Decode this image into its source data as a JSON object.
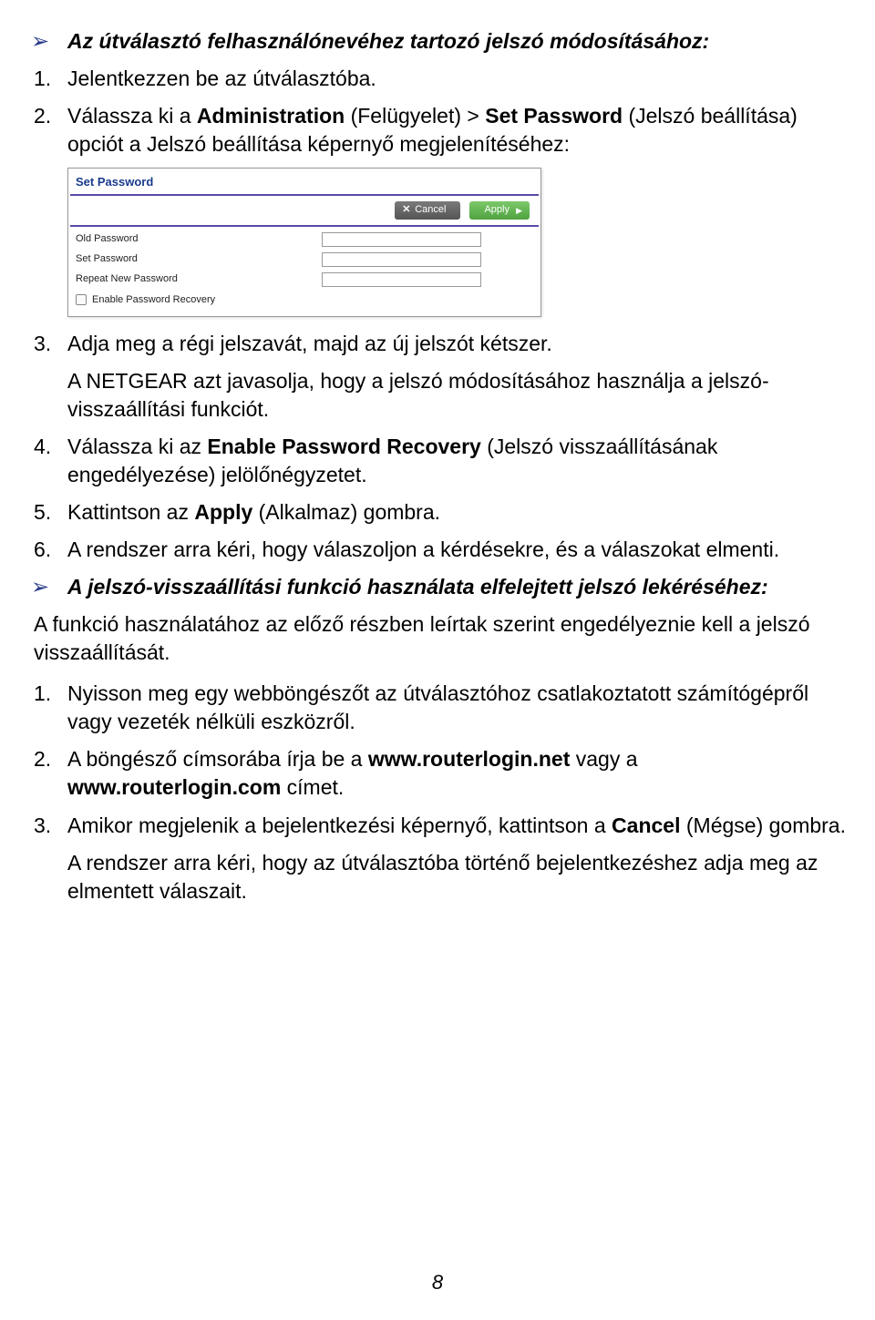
{
  "section1": {
    "title": "Az útválasztó felhasználónevéhez tartozó jelszó módosításához:",
    "items": [
      {
        "num": "1.",
        "text": "Jelentkezzen be az útválasztóba."
      },
      {
        "num": "2.",
        "pre": "Válassza ki a ",
        "b1": "Administration",
        "mid1": " (Felügyelet) > ",
        "b2": "Set Password",
        "post": " (Jelszó beállítása) opciót a Jelszó beállítása képernyő megjelenítéséhez:"
      }
    ]
  },
  "shot": {
    "title": "Set Password",
    "cancel": "Cancel",
    "apply": "Apply",
    "rows": [
      "Old Password",
      "Set Password",
      "Repeat New Password"
    ],
    "checkbox": "Enable Password Recovery"
  },
  "section1b": {
    "items": [
      {
        "num": "3.",
        "text": "Adja meg a régi jelszavát, majd az új jelszót kétszer.",
        "sub": "A NETGEAR azt javasolja, hogy a jelszó módosításához használja a jelszó-visszaállítási funkciót."
      },
      {
        "num": "4.",
        "pre": "Válassza ki az ",
        "b1": "Enable Password Recovery",
        "post": " (Jelszó visszaállításának engedélyezése) jelölőnégyzetet."
      },
      {
        "num": "5.",
        "pre": "Kattintson az ",
        "b1": "Apply",
        "post": " (Alkalmaz) gombra."
      },
      {
        "num": "6.",
        "text": "A rendszer arra kéri, hogy válaszoljon a kérdésekre, és a válaszokat elmenti."
      }
    ]
  },
  "section2": {
    "title": "A jelszó-visszaállítási funkció használata elfelejtett jelszó lekéréséhez:",
    "intro": "A funkció használatához az előző részben leírtak szerint engedélyeznie kell a jelszó visszaállítását.",
    "items": [
      {
        "num": "1.",
        "text": "Nyisson meg egy webböngészőt az útválasztóhoz csatlakoztatott számítógépről vagy vezeték nélküli eszközről."
      },
      {
        "num": "2.",
        "pre": "A böngésző címsorába írja be a ",
        "b1": "www.routerlogin.net",
        "mid1": " vagy a ",
        "b2": "www.routerlogin.com",
        "post": " címet."
      },
      {
        "num": "3.",
        "pre": "Amikor megjelenik a bejelentkezési képernyő, kattintson a ",
        "b1": "Cancel",
        "post": " (Mégse) gombra.",
        "sub": "A rendszer arra kéri, hogy az útválasztóba történő bejelentkezéshez adja meg az elmentett válaszait."
      }
    ]
  },
  "page_number": "8"
}
